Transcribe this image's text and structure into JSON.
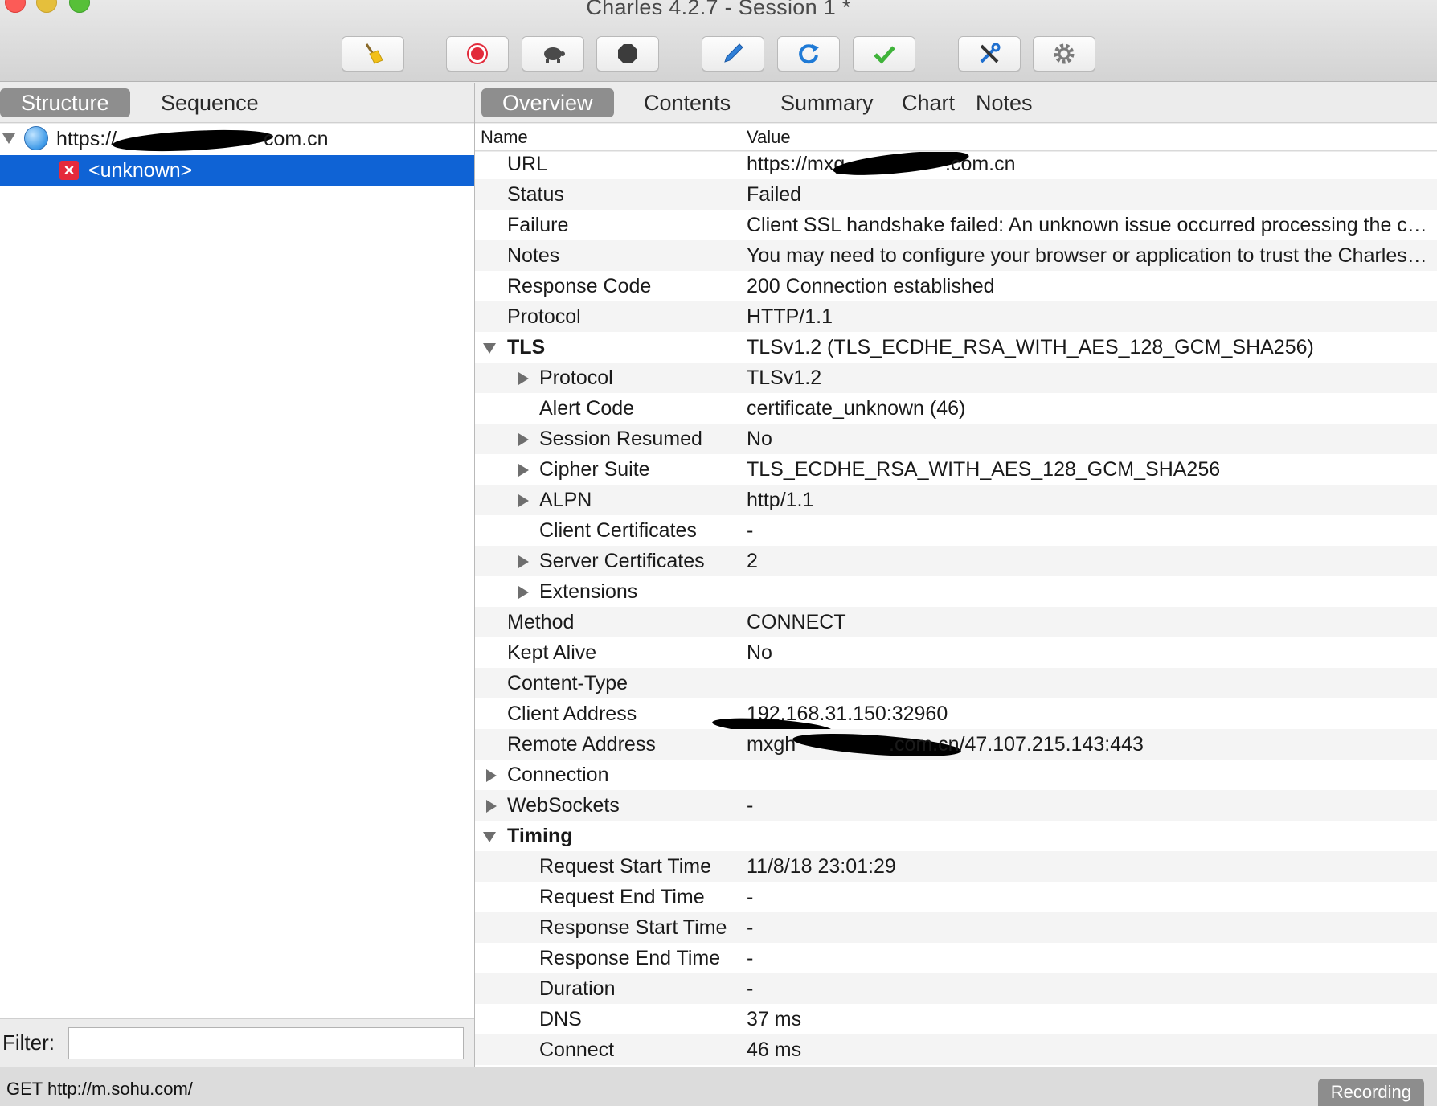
{
  "window": {
    "title": "Charles 4.2.7 - Session 1 *"
  },
  "toolbar": {
    "icons": [
      "broom-icon",
      "record-icon",
      "turtle-icon",
      "stop-icon",
      "pen-icon",
      "refresh-icon",
      "check-icon",
      "tools-icon",
      "gear-icon"
    ]
  },
  "left": {
    "tabs": [
      "Structure",
      "Sequence"
    ],
    "active_tab": "Structure",
    "tree": [
      {
        "label_start": "https://",
        "label_end": "com.cn",
        "expanded": true
      },
      {
        "label": "<unknown>",
        "selected": true
      }
    ],
    "filter_label": "Filter:",
    "filter_value": ""
  },
  "right": {
    "tabs": [
      "Overview",
      "Contents",
      "Summary",
      "Chart",
      "Notes"
    ],
    "active_tab": "Overview",
    "columns": [
      "Name",
      "Value"
    ],
    "rows": [
      {
        "name": "URL",
        "value": "https://mxg",
        "value_end": ".com.cn"
      },
      {
        "name": "Status",
        "value": "Failed"
      },
      {
        "name": "Failure",
        "value": "Client SSL handshake failed: An unknown issue occurred processing the certificate (certificate_unknown)"
      },
      {
        "name": "Notes",
        "value": "You may need to configure your browser or application to trust the Charles Root Certificate. See SSL Proxying in the Help menu."
      },
      {
        "name": "Response Code",
        "value": "200 Connection established"
      },
      {
        "name": "Protocol",
        "value": "HTTP/1.1"
      },
      {
        "name": "TLS",
        "value": "TLSv1.2 (TLS_ECDHE_RSA_WITH_AES_128_GCM_SHA256)"
      },
      {
        "name": "Protocol",
        "value": "TLSv1.2"
      },
      {
        "name": "Alert Code",
        "value": "certificate_unknown (46)"
      },
      {
        "name": "Session Resumed",
        "value": "No"
      },
      {
        "name": "Cipher Suite",
        "value": "TLS_ECDHE_RSA_WITH_AES_128_GCM_SHA256"
      },
      {
        "name": "ALPN",
        "value": "http/1.1"
      },
      {
        "name": "Client Certificates",
        "value": "-"
      },
      {
        "name": "Server Certificates",
        "value": "2"
      },
      {
        "name": "Extensions",
        "value": ""
      },
      {
        "name": "Method",
        "value": "CONNECT"
      },
      {
        "name": "Kept Alive",
        "value": "No"
      },
      {
        "name": "Content-Type",
        "value": ""
      },
      {
        "name": "Client Address",
        "value": "192.168.31.150:32960"
      },
      {
        "name": "Remote Address",
        "value": "mxgh",
        "value_end": ".com.cn/47.107.215.143:443"
      },
      {
        "name": "Connection",
        "value": ""
      },
      {
        "name": "WebSockets",
        "value": "-"
      },
      {
        "name": "Timing",
        "value": ""
      },
      {
        "name": "Request Start Time",
        "value": "11/8/18 23:01:29"
      },
      {
        "name": "Request End Time",
        "value": "-"
      },
      {
        "name": "Response Start Time",
        "value": "-"
      },
      {
        "name": "Response End Time",
        "value": "-"
      },
      {
        "name": "Duration",
        "value": "-"
      },
      {
        "name": "DNS",
        "value": "37 ms"
      },
      {
        "name": "Connect",
        "value": "46 ms"
      }
    ]
  },
  "status": {
    "text": "GET http://m.sohu.com/",
    "recording": "Recording"
  }
}
